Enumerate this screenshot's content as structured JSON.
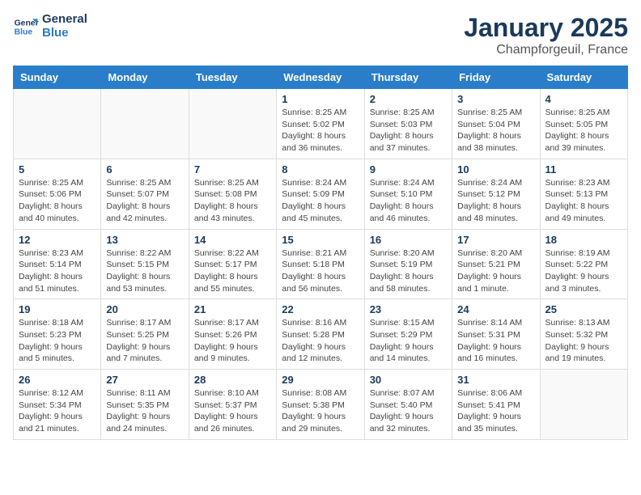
{
  "header": {
    "logo_line1": "General",
    "logo_line2": "Blue",
    "month": "January 2025",
    "location": "Champforgeuil, France"
  },
  "weekdays": [
    "Sunday",
    "Monday",
    "Tuesday",
    "Wednesday",
    "Thursday",
    "Friday",
    "Saturday"
  ],
  "weeks": [
    [
      {
        "day": "",
        "info": ""
      },
      {
        "day": "",
        "info": ""
      },
      {
        "day": "",
        "info": ""
      },
      {
        "day": "1",
        "info": "Sunrise: 8:25 AM\nSunset: 5:02 PM\nDaylight: 8 hours and 36 minutes."
      },
      {
        "day": "2",
        "info": "Sunrise: 8:25 AM\nSunset: 5:03 PM\nDaylight: 8 hours and 37 minutes."
      },
      {
        "day": "3",
        "info": "Sunrise: 8:25 AM\nSunset: 5:04 PM\nDaylight: 8 hours and 38 minutes."
      },
      {
        "day": "4",
        "info": "Sunrise: 8:25 AM\nSunset: 5:05 PM\nDaylight: 8 hours and 39 minutes."
      }
    ],
    [
      {
        "day": "5",
        "info": "Sunrise: 8:25 AM\nSunset: 5:06 PM\nDaylight: 8 hours and 40 minutes."
      },
      {
        "day": "6",
        "info": "Sunrise: 8:25 AM\nSunset: 5:07 PM\nDaylight: 8 hours and 42 minutes."
      },
      {
        "day": "7",
        "info": "Sunrise: 8:25 AM\nSunset: 5:08 PM\nDaylight: 8 hours and 43 minutes."
      },
      {
        "day": "8",
        "info": "Sunrise: 8:24 AM\nSunset: 5:09 PM\nDaylight: 8 hours and 45 minutes."
      },
      {
        "day": "9",
        "info": "Sunrise: 8:24 AM\nSunset: 5:10 PM\nDaylight: 8 hours and 46 minutes."
      },
      {
        "day": "10",
        "info": "Sunrise: 8:24 AM\nSunset: 5:12 PM\nDaylight: 8 hours and 48 minutes."
      },
      {
        "day": "11",
        "info": "Sunrise: 8:23 AM\nSunset: 5:13 PM\nDaylight: 8 hours and 49 minutes."
      }
    ],
    [
      {
        "day": "12",
        "info": "Sunrise: 8:23 AM\nSunset: 5:14 PM\nDaylight: 8 hours and 51 minutes."
      },
      {
        "day": "13",
        "info": "Sunrise: 8:22 AM\nSunset: 5:15 PM\nDaylight: 8 hours and 53 minutes."
      },
      {
        "day": "14",
        "info": "Sunrise: 8:22 AM\nSunset: 5:17 PM\nDaylight: 8 hours and 55 minutes."
      },
      {
        "day": "15",
        "info": "Sunrise: 8:21 AM\nSunset: 5:18 PM\nDaylight: 8 hours and 56 minutes."
      },
      {
        "day": "16",
        "info": "Sunrise: 8:20 AM\nSunset: 5:19 PM\nDaylight: 8 hours and 58 minutes."
      },
      {
        "day": "17",
        "info": "Sunrise: 8:20 AM\nSunset: 5:21 PM\nDaylight: 9 hours and 1 minute."
      },
      {
        "day": "18",
        "info": "Sunrise: 8:19 AM\nSunset: 5:22 PM\nDaylight: 9 hours and 3 minutes."
      }
    ],
    [
      {
        "day": "19",
        "info": "Sunrise: 8:18 AM\nSunset: 5:23 PM\nDaylight: 9 hours and 5 minutes."
      },
      {
        "day": "20",
        "info": "Sunrise: 8:17 AM\nSunset: 5:25 PM\nDaylight: 9 hours and 7 minutes."
      },
      {
        "day": "21",
        "info": "Sunrise: 8:17 AM\nSunset: 5:26 PM\nDaylight: 9 hours and 9 minutes."
      },
      {
        "day": "22",
        "info": "Sunrise: 8:16 AM\nSunset: 5:28 PM\nDaylight: 9 hours and 12 minutes."
      },
      {
        "day": "23",
        "info": "Sunrise: 8:15 AM\nSunset: 5:29 PM\nDaylight: 9 hours and 14 minutes."
      },
      {
        "day": "24",
        "info": "Sunrise: 8:14 AM\nSunset: 5:31 PM\nDaylight: 9 hours and 16 minutes."
      },
      {
        "day": "25",
        "info": "Sunrise: 8:13 AM\nSunset: 5:32 PM\nDaylight: 9 hours and 19 minutes."
      }
    ],
    [
      {
        "day": "26",
        "info": "Sunrise: 8:12 AM\nSunset: 5:34 PM\nDaylight: 9 hours and 21 minutes."
      },
      {
        "day": "27",
        "info": "Sunrise: 8:11 AM\nSunset: 5:35 PM\nDaylight: 9 hours and 24 minutes."
      },
      {
        "day": "28",
        "info": "Sunrise: 8:10 AM\nSunset: 5:37 PM\nDaylight: 9 hours and 26 minutes."
      },
      {
        "day": "29",
        "info": "Sunrise: 8:08 AM\nSunset: 5:38 PM\nDaylight: 9 hours and 29 minutes."
      },
      {
        "day": "30",
        "info": "Sunrise: 8:07 AM\nSunset: 5:40 PM\nDaylight: 9 hours and 32 minutes."
      },
      {
        "day": "31",
        "info": "Sunrise: 8:06 AM\nSunset: 5:41 PM\nDaylight: 9 hours and 35 minutes."
      },
      {
        "day": "",
        "info": ""
      }
    ]
  ]
}
